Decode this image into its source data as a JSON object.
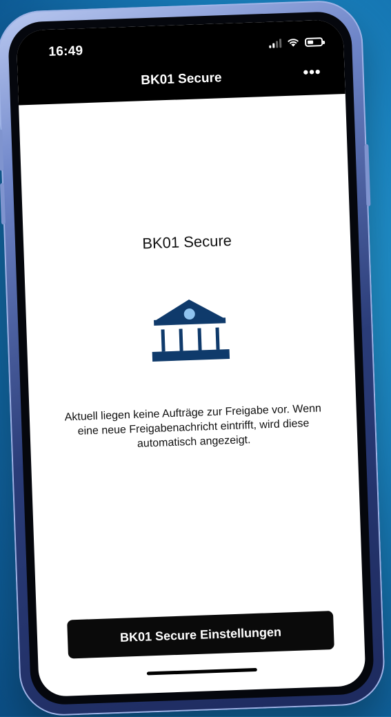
{
  "status_bar": {
    "time": "16:49",
    "icons": [
      "signal-icon",
      "wifi-icon",
      "battery-icon"
    ]
  },
  "nav": {
    "title": "BK01 Secure",
    "more_label": "•••"
  },
  "main": {
    "title": "BK01 Secure",
    "icon": "bank-icon",
    "icon_color": "#0f3a6b",
    "icon_accent": "#8fc3ef",
    "message": "Aktuell liegen keine Aufträge zur Freigabe vor. Wenn eine neue Freigabenachricht eintrifft, wird diese automatisch angezeigt."
  },
  "footer": {
    "settings_button": "BK01 Secure Einstellungen"
  }
}
